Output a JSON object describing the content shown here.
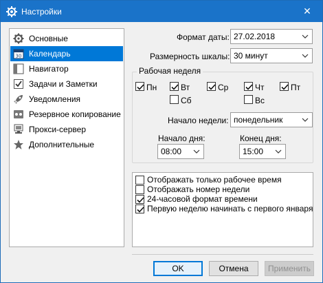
{
  "window": {
    "title": "Настройки",
    "close_glyph": "✕"
  },
  "sidebar": {
    "items": [
      {
        "label": "Основные",
        "icon": "gear-icon"
      },
      {
        "label": "Календарь",
        "icon": "calendar-icon",
        "selected": true
      },
      {
        "label": "Навигатор",
        "icon": "navigator-icon"
      },
      {
        "label": "Задачи и Заметки",
        "icon": "checkbox-icon"
      },
      {
        "label": "Уведомления",
        "icon": "rocket-icon"
      },
      {
        "label": "Резервное копирование",
        "icon": "backup-icon"
      },
      {
        "label": "Прокси-сервер",
        "icon": "proxy-icon"
      },
      {
        "label": "Дополнительные",
        "icon": "star-icon"
      }
    ]
  },
  "form": {
    "date_format_label": "Формат даты:",
    "date_format_value": "27.02.2018",
    "scale_label": "Размерность шкалы:",
    "scale_value": "30 минут"
  },
  "workweek": {
    "title": "Рабочая неделя",
    "days": [
      {
        "label": "Пн",
        "checked": true
      },
      {
        "label": "Вт",
        "checked": true
      },
      {
        "label": "Ср",
        "checked": true
      },
      {
        "label": "Чт",
        "checked": true
      },
      {
        "label": "Пт",
        "checked": true
      },
      {
        "label": "Сб",
        "checked": false
      },
      {
        "label": "Вс",
        "checked": false
      }
    ],
    "week_start_label": "Начало недели:",
    "week_start_value": "понедельник",
    "day_start_label": "Начало дня:",
    "day_start_value": "08:00",
    "day_end_label": "Конец дня:",
    "day_end_value": "15:00"
  },
  "options": [
    {
      "label": "Отображать только рабочее время",
      "checked": false
    },
    {
      "label": "Отображать номер недели",
      "checked": false
    },
    {
      "label": "24-часовой формат времени",
      "checked": true
    },
    {
      "label": "Первую неделю начинать с первого января",
      "checked": true
    }
  ],
  "buttons": {
    "ok": "OK",
    "cancel": "Отмена",
    "apply": "Применить"
  },
  "colors": {
    "accent": "#0078d7",
    "titlebar": "#1a73c9"
  }
}
